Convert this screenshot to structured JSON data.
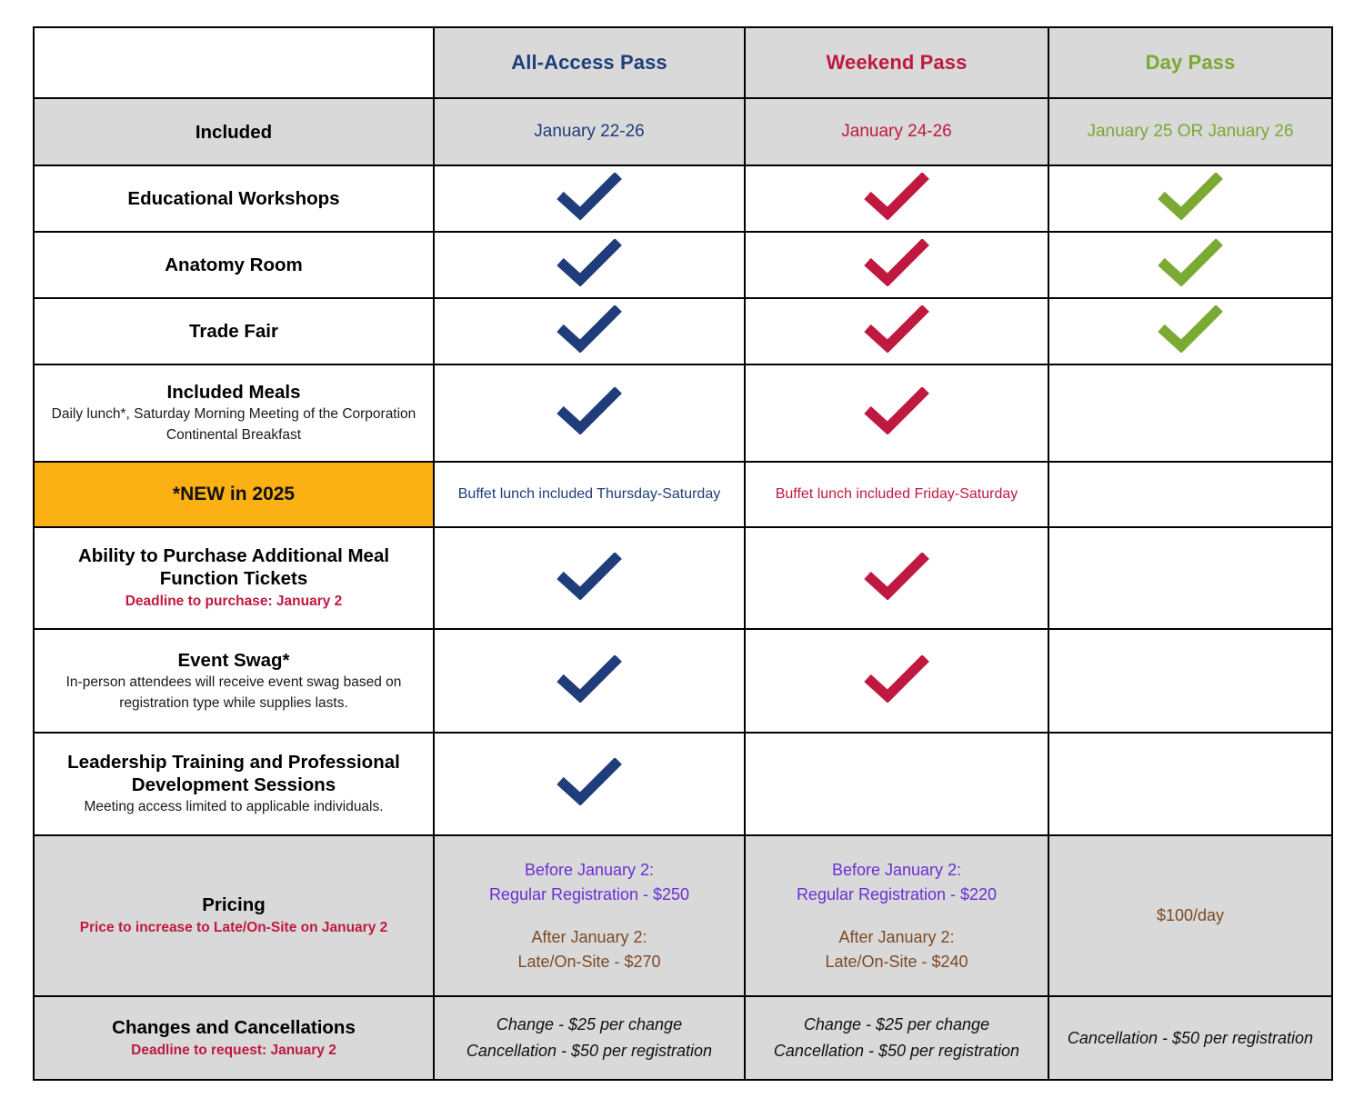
{
  "table": {
    "columns": [
      {
        "key": "label",
        "label": ""
      },
      {
        "key": "all_access",
        "label": "All-Access Pass",
        "color": "#1f3d7a"
      },
      {
        "key": "weekend",
        "label": "Weekend Pass",
        "color": "#bf1940"
      },
      {
        "key": "day",
        "label": "Day Pass",
        "color": "#7aa934"
      }
    ],
    "rows": {
      "included": {
        "label": "Included",
        "all_access": "January 22-26",
        "weekend": "January 24-26",
        "day": "January 25 OR January 26"
      },
      "workshops": {
        "label": "Educational Workshops",
        "all_access": "check",
        "weekend": "check",
        "day": "check"
      },
      "anatomy": {
        "label": "Anatomy Room",
        "all_access": "check",
        "weekend": "check",
        "day": "check"
      },
      "trade_fair": {
        "label": "Trade Fair",
        "all_access": "check",
        "weekend": "check",
        "day": "check"
      },
      "meals": {
        "label": "Included Meals",
        "sub_line1": "Daily lunch*, Saturday Morning Meeting of the Corporation",
        "sub_line2": "Continental Breakfast",
        "all_access": "check",
        "weekend": "check",
        "day": ""
      },
      "new_2025": {
        "label": "*NEW in 2025",
        "all_access": "Buffet lunch included Thursday-Saturday",
        "weekend": "Buffet lunch included Friday-Saturday",
        "day": ""
      },
      "meal_tickets": {
        "label_line1": "Ability to Purchase Additional Meal",
        "label_line2": "Function Tickets",
        "deadline": "Deadline to purchase: January 2",
        "all_access": "check",
        "weekend": "check",
        "day": ""
      },
      "event_swag": {
        "label": "Event Swag*",
        "sub_line1": "In-person attendees will receive event swag based on",
        "sub_line2": "registration type while supplies lasts.",
        "all_access": "check",
        "weekend": "check",
        "day": ""
      },
      "leadership": {
        "label_line1": "Leadership Training and Professional",
        "label_line2": "Development Sessions",
        "sub": "Meeting access limited to applicable individuals.",
        "all_access": "check",
        "weekend": "",
        "day": ""
      },
      "pricing": {
        "label": "Pricing",
        "note": "Price to increase to Late/On-Site on January 2",
        "all_access": {
          "before_head": "Before January 2:",
          "before_value": "Regular Registration - $250",
          "after_head": "After January 2:",
          "after_value": "Late/On-Site - $270"
        },
        "weekend": {
          "before_head": "Before January 2:",
          "before_value": "Regular Registration - $220",
          "after_head": "After January 2:",
          "after_value": "Late/On-Site - $240"
        },
        "day": "$100/day"
      },
      "changes": {
        "label": "Changes and Cancellations",
        "deadline": "Deadline to request: January 2",
        "all_access_line1": "Change - $25 per change",
        "all_access_line2": "Cancellation - $50 per registration",
        "weekend_line1": "Change - $25 per change",
        "weekend_line2": "Cancellation - $50 per registration",
        "day_line1": "Cancellation - $50 per registration"
      }
    }
  },
  "colors": {
    "navy": "#1f3d7a",
    "crimson": "#bf1940",
    "green": "#7aa934",
    "amber": "#fbb014",
    "grey": "#d9d9d9",
    "purple": "#6a2fd4",
    "brown": "#7b4a26"
  },
  "icons": {
    "check": "check-icon"
  }
}
